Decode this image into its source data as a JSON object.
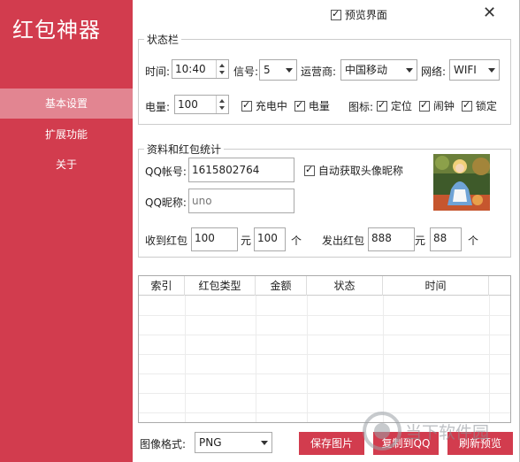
{
  "app": {
    "title": "红包神器"
  },
  "sidebar": {
    "items": [
      {
        "label": "基本设置"
      },
      {
        "label": "扩展功能"
      },
      {
        "label": "关于"
      }
    ]
  },
  "top": {
    "preview_label": "预览界面",
    "preview_checked": true
  },
  "status_bar": {
    "title": "状态栏",
    "time_label": "时间:",
    "time_value": "10:40",
    "signal_label": "信号:",
    "signal_value": "5",
    "carrier_label": "运营商:",
    "carrier_value": "中国移动",
    "network_label": "网络:",
    "network_value": "WIFI",
    "battery_label": "电量:",
    "battery_value": "100",
    "charging_label": "充电中",
    "battery_check_label": "电量",
    "icons_label": "图标:",
    "location_label": "定位",
    "alarm_label": "闹钟",
    "lock_label": "锁定"
  },
  "profile": {
    "title": "资料和红包统计",
    "qq_label": "QQ帐号:",
    "qq_value": "1615802764",
    "auto_avatar_label": "自动获取头像昵称",
    "nick_label": "QQ昵称:",
    "nick_placeholder": "uno",
    "received_label": "收到红包",
    "received_count": "100",
    "yuan1": "元",
    "received_amount": "100",
    "ge1": "个",
    "sent_label": "发出红包",
    "sent_count": "888",
    "yuan2": "元",
    "sent_amount": "88",
    "ge2": "个"
  },
  "table": {
    "headers": [
      "索引",
      "红包类型",
      "金额",
      "状态",
      "时间"
    ]
  },
  "bottom": {
    "format_label": "图像格式:",
    "format_value": "PNG",
    "save_label": "保存图片",
    "copy_label": "复制到QQ",
    "refresh_label": "刷新预览"
  },
  "watermark": {
    "text": "当下软件园"
  },
  "colors": {
    "accent": "#d23c4e",
    "sidebar_active": "#e28591"
  }
}
